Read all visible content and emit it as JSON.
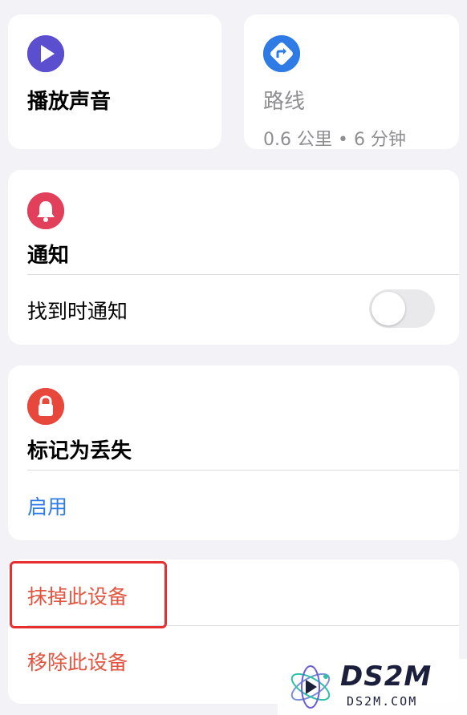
{
  "actions": {
    "play_sound": {
      "label": "播放声音",
      "icon": "play-icon",
      "color": "#5b4fcf"
    },
    "route": {
      "label": "路线",
      "detail": "0.6 公里 • 6 分钟",
      "icon": "directions-icon",
      "color": "#2f7be6"
    }
  },
  "notifications": {
    "title": "通知",
    "icon": "bell-icon",
    "color": "#e2405a",
    "row_label": "找到时通知",
    "toggle_on": false
  },
  "lost_mode": {
    "title": "标记为丢失",
    "icon": "lock-icon",
    "color": "#e8483c",
    "action_label": "启用"
  },
  "device": {
    "erase_label": "抹掉此设备",
    "remove_label": "移除此设备"
  },
  "watermark": {
    "title": "DS2M",
    "url": "DS2M.COM"
  }
}
